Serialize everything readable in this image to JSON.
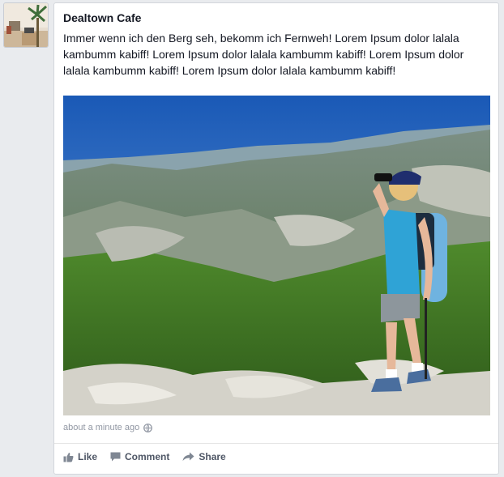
{
  "post": {
    "author": "Dealtown Cafe",
    "message": "Immer wenn ich den Berg seh, bekomm ich Fernweh! Lorem Ipsum dolor lalala kambumm kabiff! Lorem Ipsum dolor lalala kambumm kabiff! Lorem Ipsum dolor lalala kambumm kabiff! Lorem Ipsum dolor lalala kambumm kabiff!",
    "timestamp": "about a minute ago",
    "privacy_icon": "globe-icon"
  },
  "actions": {
    "like_label": "Like",
    "comment_label": "Comment",
    "share_label": "Share"
  },
  "colors": {
    "page_bg": "#e9ebee",
    "author_text": "#141823",
    "meta_text": "#9197a3",
    "action_text": "#4e5665"
  }
}
